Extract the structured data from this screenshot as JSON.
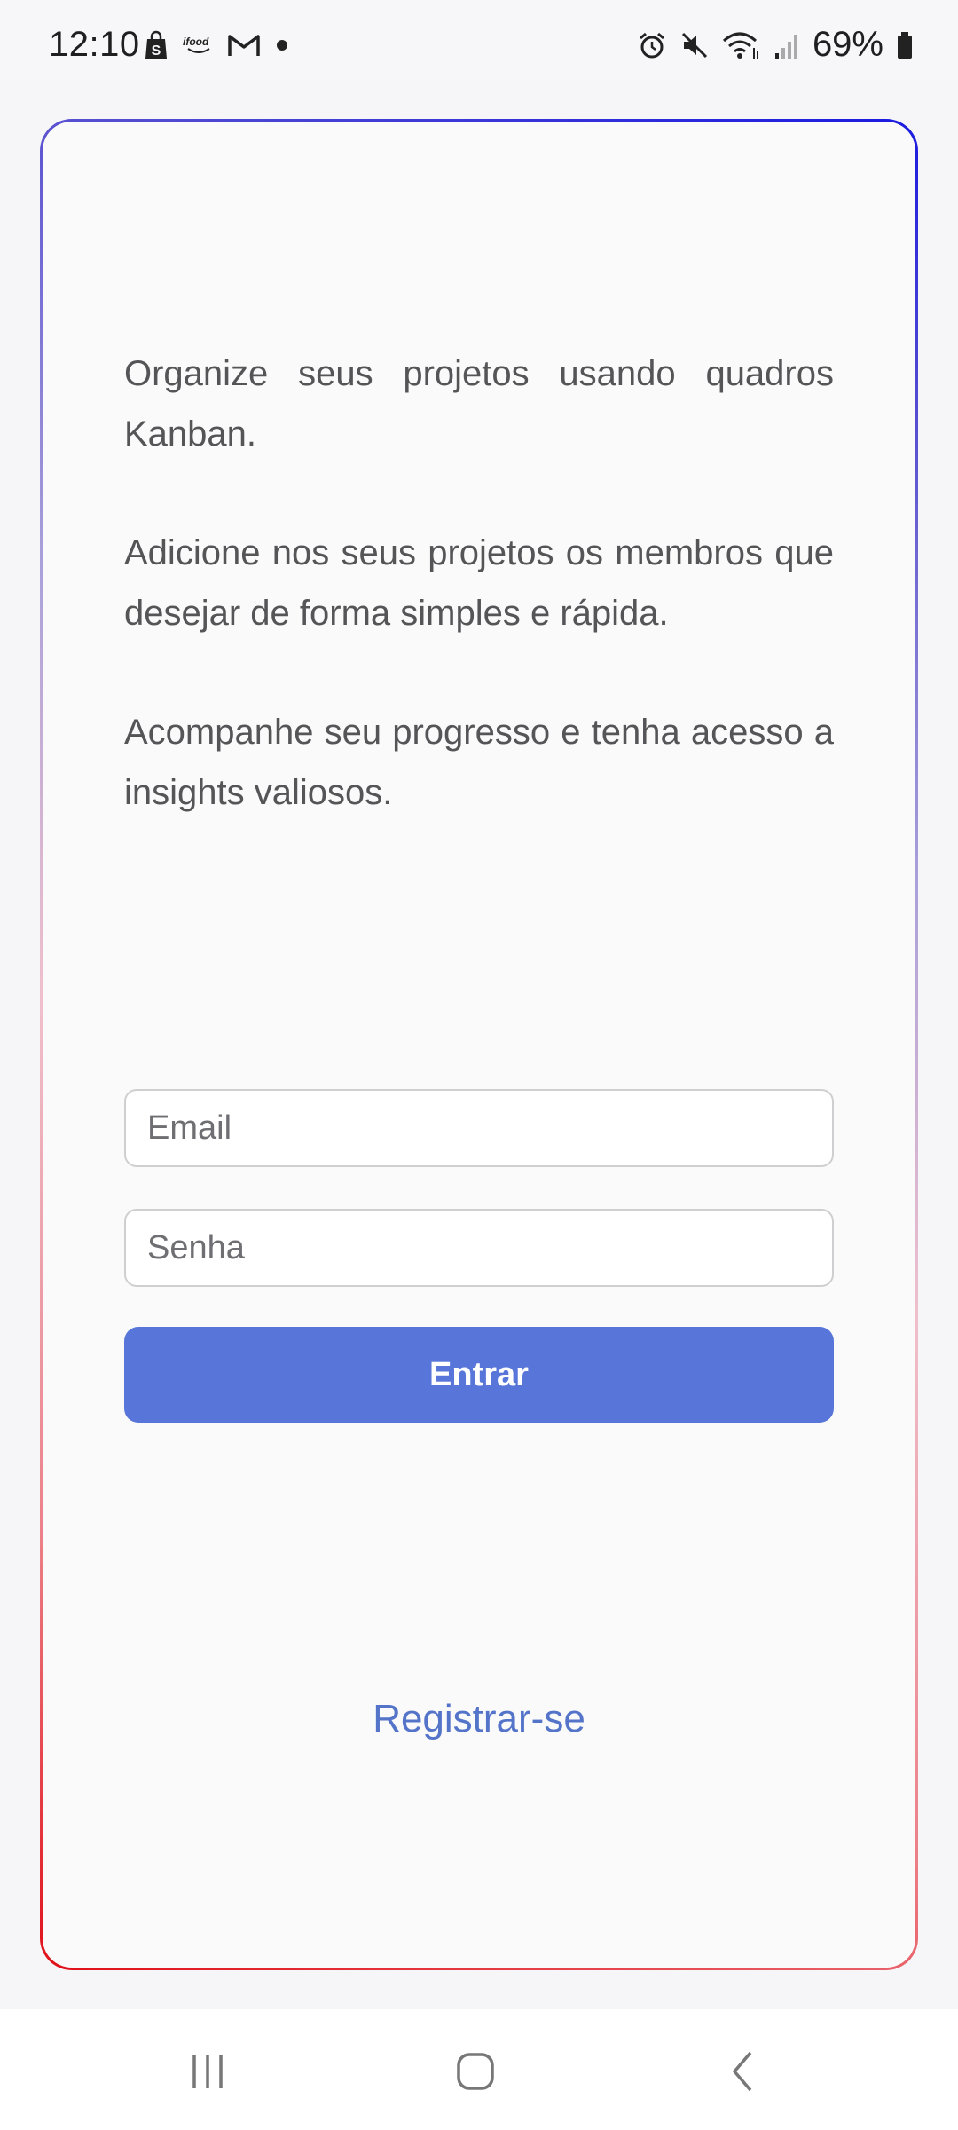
{
  "status_bar": {
    "time": "12:10",
    "battery": "69%",
    "left_icons": [
      "shopping-bag-icon",
      "ifood-icon",
      "gmail-icon",
      "dot-icon"
    ],
    "right_icons": [
      "alarm-icon",
      "mute-icon",
      "wifi-icon",
      "signal-icon",
      "battery-icon"
    ],
    "ifood_label": "ifood"
  },
  "features": [
    "Organize seus projetos usando quadros Kanban.",
    "Adicione nos seus projetos os membros que desejar de forma simples e rápida.",
    "Acompanhe seu progresso e tenha acesso a insights valiosos."
  ],
  "login_form": {
    "email_placeholder": "Email",
    "password_placeholder": "Senha",
    "submit_label": "Entrar"
  },
  "register_link": "Registrar-se",
  "nav_bar": {
    "items": [
      "recent-apps-icon",
      "home-icon",
      "back-icon"
    ]
  },
  "colors": {
    "accent": "#5876d9",
    "link": "#5474c9",
    "border_gradient_top": "#1a1ae0",
    "border_gradient_bottom": "#e01018"
  }
}
